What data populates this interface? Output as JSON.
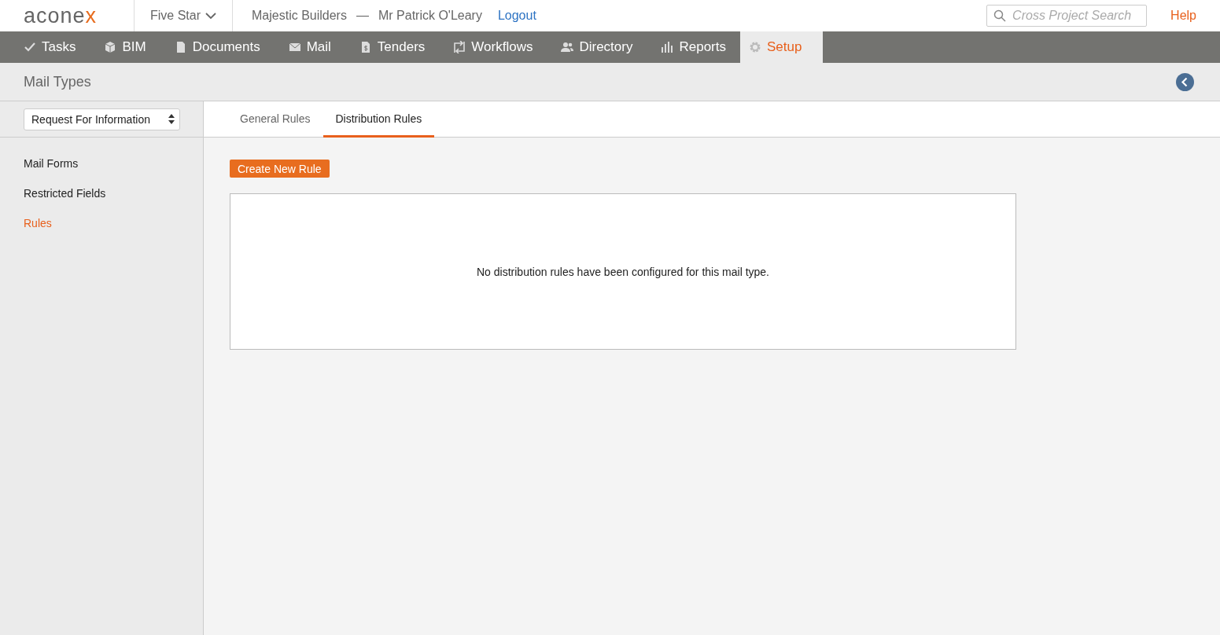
{
  "header": {
    "logo": "aconex",
    "project": "Five Star",
    "organization": "Majestic Builders",
    "separator": "—",
    "user": "Mr Patrick O'Leary",
    "logout": "Logout",
    "search": {
      "placeholder": "Cross Project Search"
    },
    "help": "Help"
  },
  "nav": [
    {
      "label": "Tasks",
      "kind": "check",
      "selected": false
    },
    {
      "label": "BIM",
      "kind": "cube",
      "selected": false
    },
    {
      "label": "Documents",
      "kind": "page",
      "selected": false
    },
    {
      "label": "Mail",
      "kind": "envelope",
      "selected": false
    },
    {
      "label": "Tenders",
      "kind": "dollar",
      "selected": false
    },
    {
      "label": "Workflows",
      "kind": "arrows",
      "selected": false
    },
    {
      "label": "Directory",
      "kind": "people",
      "selected": false
    },
    {
      "label": "Reports",
      "kind": "bars",
      "selected": false
    },
    {
      "label": "Setup",
      "kind": "gear",
      "selected": true
    }
  ],
  "page_title": "Mail Types",
  "mail_type_select": {
    "value": "Request For Information"
  },
  "sidebar": {
    "items": [
      {
        "label": "Mail Forms",
        "selected": false
      },
      {
        "label": "Restricted Fields",
        "selected": false
      },
      {
        "label": "Rules",
        "selected": true
      }
    ]
  },
  "tabs": [
    {
      "label": "General Rules",
      "selected": false
    },
    {
      "label": "Distribution Rules",
      "selected": true
    }
  ],
  "create_button": "Create New Rule",
  "empty_message": "No distribution rules have been configured for this mail type."
}
